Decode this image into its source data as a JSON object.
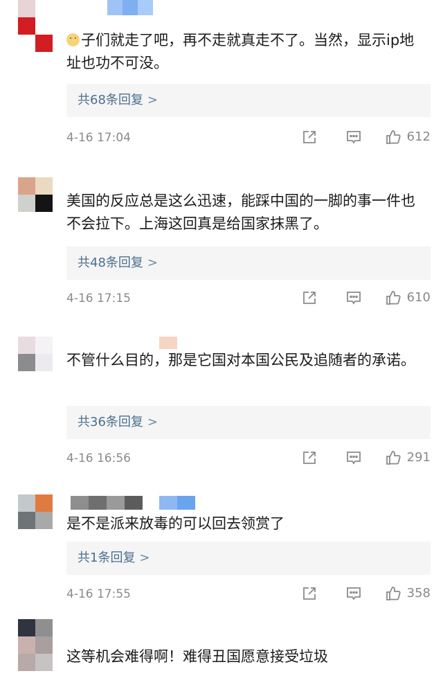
{
  "comments": [
    {
      "text": "子们就走了吧，再不走就真走不了。当然，显示ip地址也功不可没。",
      "has_emoji": true,
      "replies": "共68条回复",
      "time": "4-16 17:04",
      "likes": "612",
      "avatar_colors": [
        "#e8d3d6",
        "#ffffff",
        "#d21d22",
        "#ffffff"
      ]
    },
    {
      "text": "美国的反应总是这么迅速，能踩中国的一脚的事一件也不会拉下。上海这回真是给国家抹黑了。",
      "replies": "共48条回复",
      "time": "4-16 17:15",
      "likes": "610",
      "avatar_colors": [
        "#d9a58a",
        "#eadac0",
        "#cfd1cc",
        "#141414"
      ]
    },
    {
      "text": "不管什么目的，那是它国对本国公民及追随者的承诺。",
      "replies": "共36条回复",
      "time": "4-16 16:56",
      "likes": "291",
      "avatar_colors": [
        "#e7dde0",
        "#f4f2f5",
        "#8c8c8e",
        "#eceaee"
      ]
    },
    {
      "text": "是不是派来放毒的可以回去领赏了",
      "replies": "共1条回复",
      "time": "4-16 17:55",
      "likes": "358",
      "avatar_colors": [
        "#c3c8cd",
        "#e07b40",
        "#6d7376",
        "#a9a9a9"
      ]
    },
    {
      "text": "这等机会难得啊！难得丑国愿意接受垃圾",
      "avatar_colors": [
        "#2f3441",
        "#8f8f8f",
        "#c9b1ae",
        "#a99f9f"
      ]
    }
  ],
  "reply_chevron": ">",
  "icons": {
    "share": "share-icon",
    "comment": "comment-icon",
    "like": "thumbs-up-icon"
  }
}
